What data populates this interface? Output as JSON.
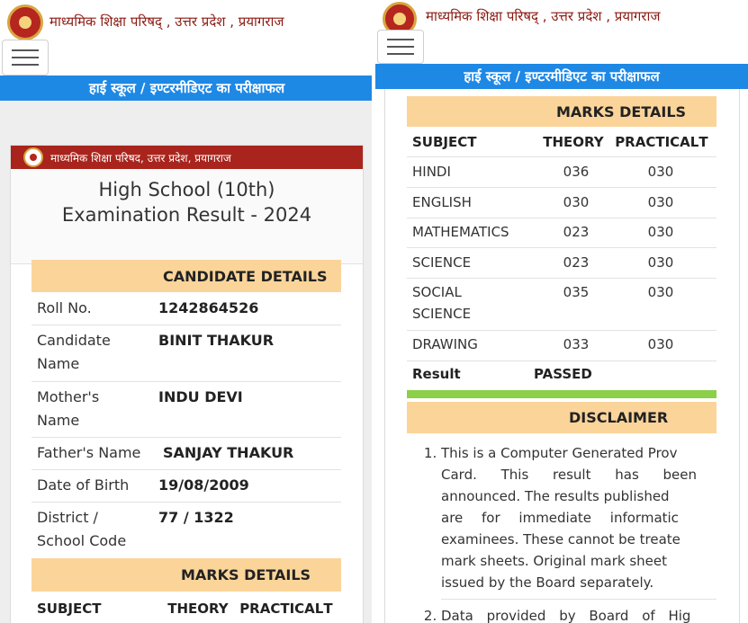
{
  "header": {
    "site_title": "माध्यमिक शिक्षा परिषद् , उत्तर प्रदेश , प्रयागराज",
    "result_bar": "हाई स्कूल / इण्टरमीडिएट का परीक्षाफल"
  },
  "card": {
    "head_text": "माध्यमिक शिक्षा परिषद, उत्तर प्रदेश, प्रयागराज",
    "title_line1": "High School (10th)",
    "title_line2": "Examination Result - 2024"
  },
  "candidate": {
    "section_title": "CANDIDATE DETAILS",
    "roll_label": "Roll No.",
    "roll_value": "1242864526",
    "name_label_1": "Candidate",
    "name_label_2": "Name",
    "name_value": "BINIT THAKUR",
    "mother_label_1": "Mother's",
    "mother_label_2": "Name",
    "mother_value": "INDU DEVI",
    "father_label": "Father's Name",
    "father_value": "SANJAY THAKUR",
    "dob_label": "Date of Birth",
    "dob_value": "19/08/2009",
    "district_label_1": "District /",
    "district_label_2": "School Code",
    "district_value": "77 / 1322"
  },
  "marks": {
    "section_title": "MARKS DETAILS",
    "col_subject": "SUBJECT",
    "col_theory": "THEORY",
    "col_practical": "PRACTICAL",
    "col_total_cut": "T",
    "rows": [
      {
        "subject": "HINDI",
        "theory": "036",
        "practical": "030"
      },
      {
        "subject": "ENGLISH",
        "theory": "030",
        "practical": "030"
      },
      {
        "subject": "MATHEMATICS",
        "theory": "023",
        "practical": "030"
      },
      {
        "subject": "SCIENCE",
        "theory": "023",
        "practical": "030"
      },
      {
        "subject_line1": "SOCIAL",
        "subject_line2": "SCIENCE",
        "theory": "035",
        "practical": "030"
      },
      {
        "subject": "DRAWING",
        "theory": "033",
        "practical": "030"
      }
    ],
    "result_label": "Result",
    "result_value": "PASSED"
  },
  "disclaimer": {
    "section_title": "DISCLAIMER",
    "item1_lines": [
      "This is a Computer Generated Prov",
      "Card. This result has been",
      "announced. The results published",
      "are for immediate informatic",
      "examinees. These cannot be treate",
      "mark sheets. Original mark sheet",
      "issued by the Board separately."
    ],
    "item2_line": "Data provided by Board of Hig"
  }
}
